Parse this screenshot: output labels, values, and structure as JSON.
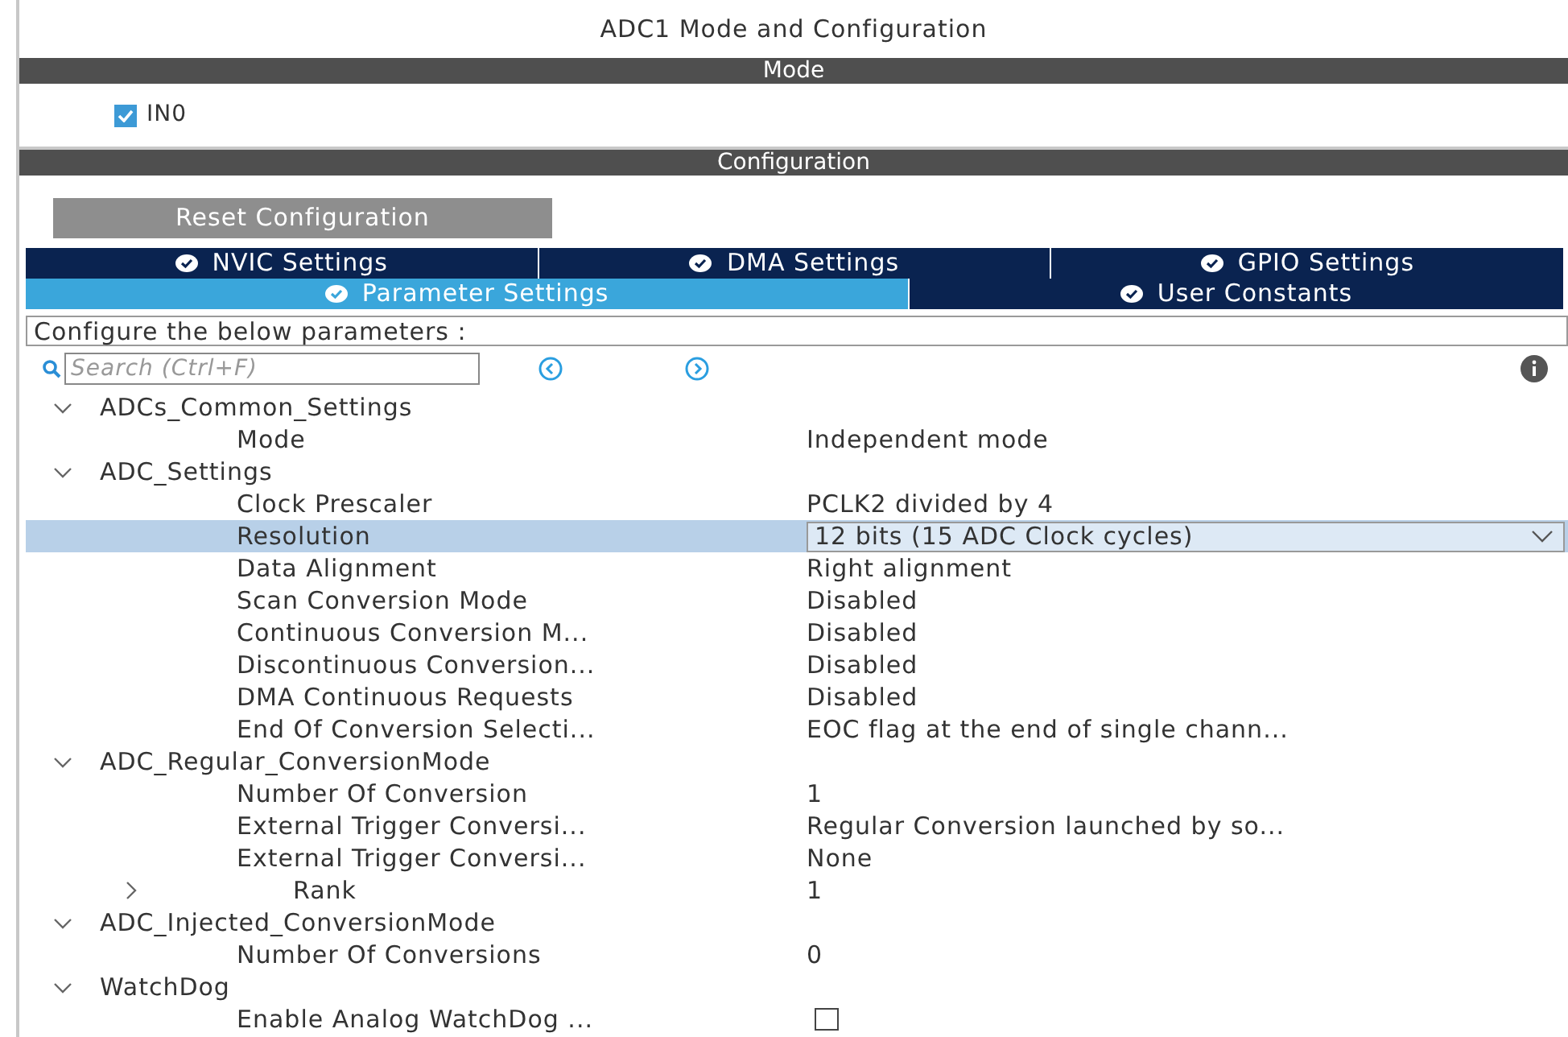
{
  "title": "ADC1 Mode and Configuration",
  "mode": {
    "header": "Mode",
    "channels": [
      {
        "label": "IN0",
        "checked": true
      }
    ]
  },
  "configuration": {
    "header": "Configuration",
    "reset_button": "Reset Configuration",
    "tab_rows": [
      [
        {
          "label": "NVIC Settings",
          "selected": false
        },
        {
          "label": "DMA Settings",
          "selected": false
        },
        {
          "label": "GPIO Settings",
          "selected": false
        }
      ],
      [
        {
          "label": "Parameter Settings",
          "selected": true
        },
        {
          "label": "User Constants",
          "selected": false
        }
      ]
    ],
    "hint": "Configure the below parameters :",
    "search": {
      "placeholder": "Search (Ctrl+F)"
    },
    "tree": [
      {
        "label": "ADCs_Common_Settings",
        "expanded": true,
        "children": [
          {
            "label": "Mode",
            "kind": "value",
            "value": "Independent mode",
            "selected": false
          }
        ]
      },
      {
        "label": "ADC_Settings",
        "expanded": true,
        "children": [
          {
            "label": "Clock Prescaler",
            "kind": "value",
            "value": "PCLK2 divided by 4",
            "selected": false
          },
          {
            "label": "Resolution",
            "kind": "dropdown",
            "value": "12 bits (15 ADC Clock cycles)",
            "selected": true
          },
          {
            "label": "Data Alignment",
            "kind": "value",
            "value": "Right alignment",
            "selected": false
          },
          {
            "label": "Scan Conversion Mode",
            "kind": "value",
            "value": "Disabled",
            "selected": false
          },
          {
            "label": "Continuous Conversion M...",
            "kind": "value",
            "value": "Disabled",
            "selected": false
          },
          {
            "label": "Discontinuous Conversion...",
            "kind": "value",
            "value": "Disabled",
            "selected": false
          },
          {
            "label": "DMA Continuous Requests",
            "kind": "value",
            "value": "Disabled",
            "selected": false
          },
          {
            "label": "End Of Conversion Selecti...",
            "kind": "value",
            "value": "EOC flag at the end of single chann...",
            "selected": false
          }
        ]
      },
      {
        "label": "ADC_Regular_ConversionMode",
        "expanded": true,
        "children": [
          {
            "label": "Number Of Conversion",
            "kind": "value",
            "value": "1",
            "selected": false
          },
          {
            "label": "External Trigger Conversi...",
            "kind": "value",
            "value": "Regular Conversion launched by so...",
            "selected": false
          },
          {
            "label": "External Trigger Conversi...",
            "kind": "value",
            "value": "None",
            "selected": false
          },
          {
            "label": "Rank",
            "kind": "collapsible",
            "expanded": false,
            "value": "1",
            "selected": false
          }
        ]
      },
      {
        "label": "ADC_Injected_ConversionMode",
        "expanded": true,
        "children": [
          {
            "label": "Number Of Conversions",
            "kind": "value",
            "value": "0",
            "selected": false
          }
        ]
      },
      {
        "label": "WatchDog",
        "expanded": true,
        "children": [
          {
            "label": "Enable Analog WatchDog ...",
            "kind": "checkbox",
            "checked": false,
            "selected": false
          }
        ]
      }
    ]
  }
}
